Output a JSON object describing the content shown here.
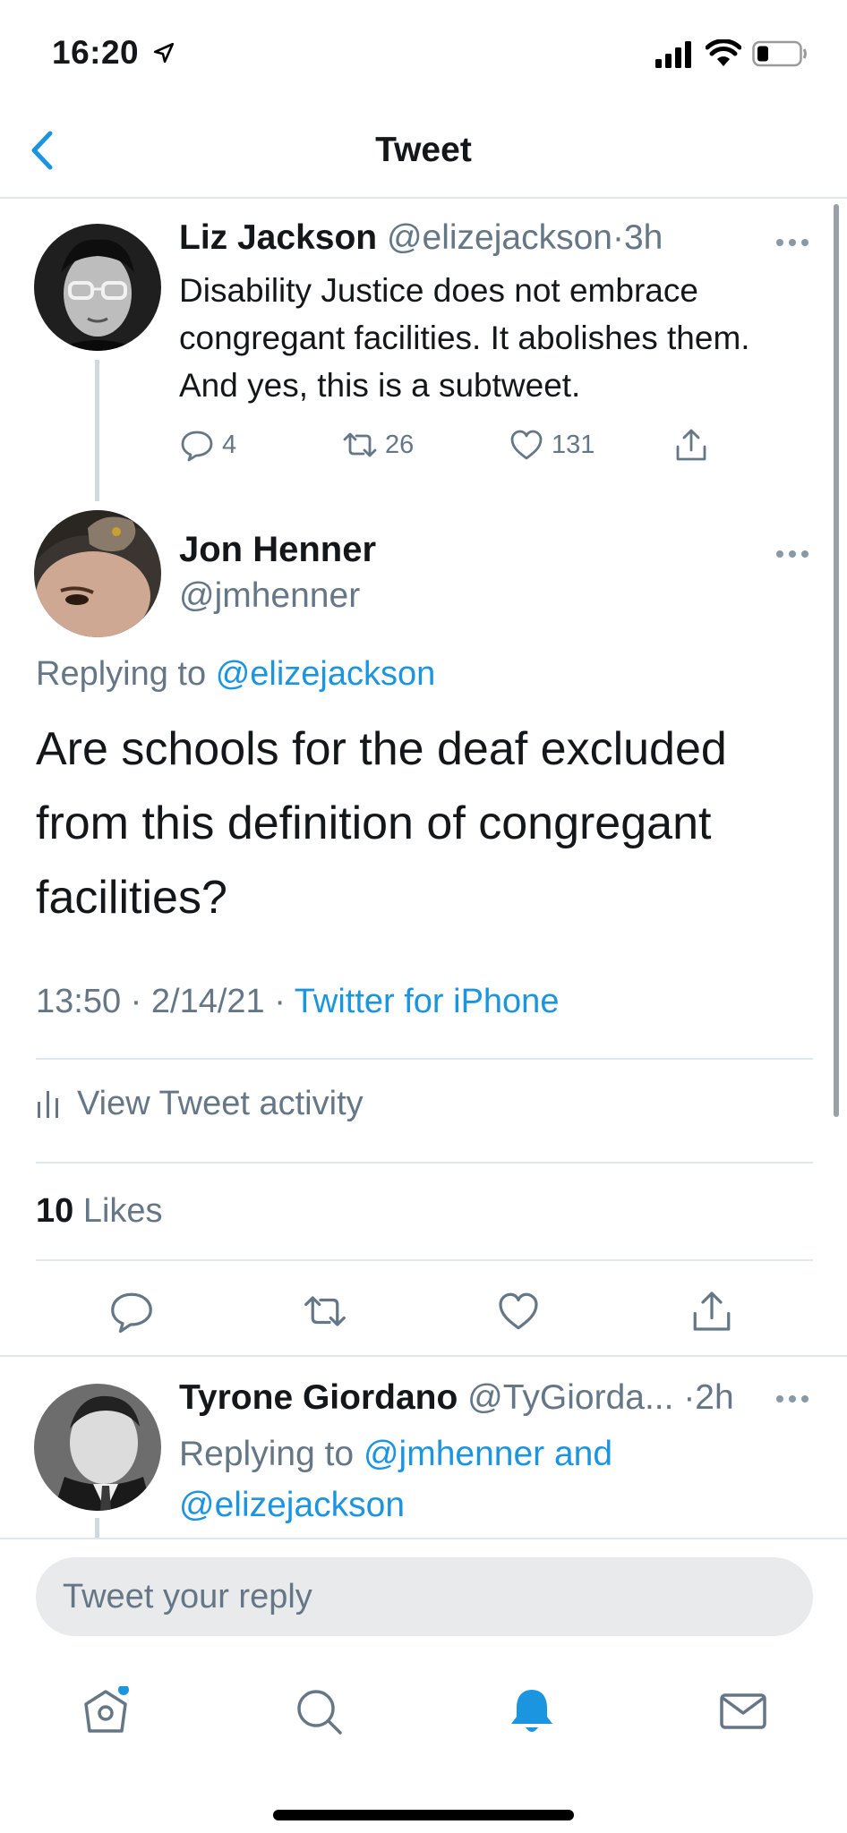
{
  "status_bar": {
    "time": "16:20"
  },
  "nav": {
    "title": "Tweet"
  },
  "parent_tweet": {
    "name": "Liz Jackson",
    "handle": "@elizejackson",
    "separator": "·",
    "time": "3h",
    "text": "Disability Justice does not embrace congregant facilities. It abolishes them. And yes, this is a subtweet.",
    "replies": "4",
    "retweets": "26",
    "likes": "131"
  },
  "main_tweet": {
    "name": "Jon Henner",
    "handle": "@jmhenner",
    "replying_prefix": "Replying to",
    "replying_to": "@elizejackson",
    "text": "Are schools for the deaf excluded from this definition of congregant facilities?",
    "time": "13:50",
    "date": "2/14/21",
    "sep": "·",
    "source": "Twitter for iPhone",
    "activity_label": "View Tweet activity",
    "likes_count": "10",
    "likes_label": "Likes"
  },
  "reply_tweet": {
    "name": "Tyrone Giordano",
    "handle": "@TyGiorda...",
    "time": "·2h",
    "replying_prefix": "Replying to",
    "replying_to": "@jmhenner and @elizejackson"
  },
  "composer": {
    "placeholder": "Tweet your reply"
  },
  "tabs": [
    "home-icon",
    "search-icon",
    "notifications-icon",
    "messages-icon"
  ],
  "colors": {
    "accent": "#1b95e0",
    "muted": "#657786",
    "text": "#14171a"
  }
}
